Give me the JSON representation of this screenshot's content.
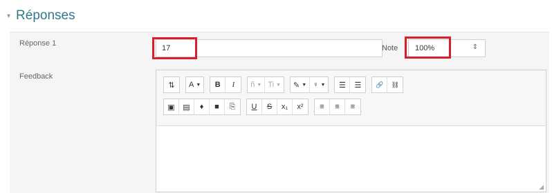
{
  "section": {
    "title": "Réponses",
    "chevron": "▾"
  },
  "answer": {
    "label": "Réponse 1",
    "value": "17"
  },
  "grade": {
    "label": "Note",
    "value": "100%",
    "arrow": "⇕"
  },
  "feedback": {
    "label": "Feedback"
  },
  "toolbar": {
    "row1": [
      {
        "id": "toggle",
        "text": "⇅",
        "icon": "collapse-toolbar-icon"
      },
      {
        "id": "style",
        "text": "A",
        "icon": "paragraph-style-dropdown"
      },
      {
        "id": "bold",
        "text": "B",
        "icon": "bold-icon"
      },
      {
        "id": "italic",
        "text": "I",
        "icon": "italic-icon"
      },
      {
        "id": "font",
        "text": "ñ",
        "icon": "font-family-dropdown"
      },
      {
        "id": "size",
        "text": "Ti",
        "icon": "font-size-dropdown"
      },
      {
        "id": "color",
        "text": "✎",
        "icon": "font-color-dropdown"
      },
      {
        "id": "bgcolor",
        "text": "♀",
        "icon": "background-color-dropdown"
      },
      {
        "id": "ul",
        "text": "☰",
        "icon": "unordered-list-icon"
      },
      {
        "id": "ol",
        "text": "☰",
        "icon": "ordered-list-icon"
      },
      {
        "id": "link",
        "text": "🔗",
        "icon": "link-icon"
      },
      {
        "id": "unlink",
        "text": "⛓",
        "icon": "unlink-icon"
      }
    ],
    "row2": [
      {
        "id": "image",
        "text": "▣",
        "icon": "image-icon"
      },
      {
        "id": "media",
        "text": "▤",
        "icon": "media-icon"
      },
      {
        "id": "audio",
        "text": "♦",
        "icon": "record-audio-icon"
      },
      {
        "id": "video",
        "text": "■",
        "icon": "record-video-icon"
      },
      {
        "id": "files",
        "text": "⎘",
        "icon": "manage-files-icon"
      },
      {
        "id": "underline",
        "text": "U",
        "icon": "underline-icon"
      },
      {
        "id": "strike",
        "text": "S",
        "icon": "strikethrough-icon"
      },
      {
        "id": "sub",
        "text": "x₁",
        "icon": "subscript-icon"
      },
      {
        "id": "sup",
        "text": "x²",
        "icon": "superscript-icon"
      },
      {
        "id": "alignleft",
        "text": "≡",
        "icon": "align-left-icon"
      },
      {
        "id": "aligncenter",
        "text": "≡",
        "icon": "align-center-icon"
      },
      {
        "id": "alignright",
        "text": "≡",
        "icon": "align-right-icon"
      }
    ]
  },
  "colors": {
    "title": "#2f7a8a",
    "highlight": "#d9202a",
    "panel": "#f5f5f5"
  }
}
